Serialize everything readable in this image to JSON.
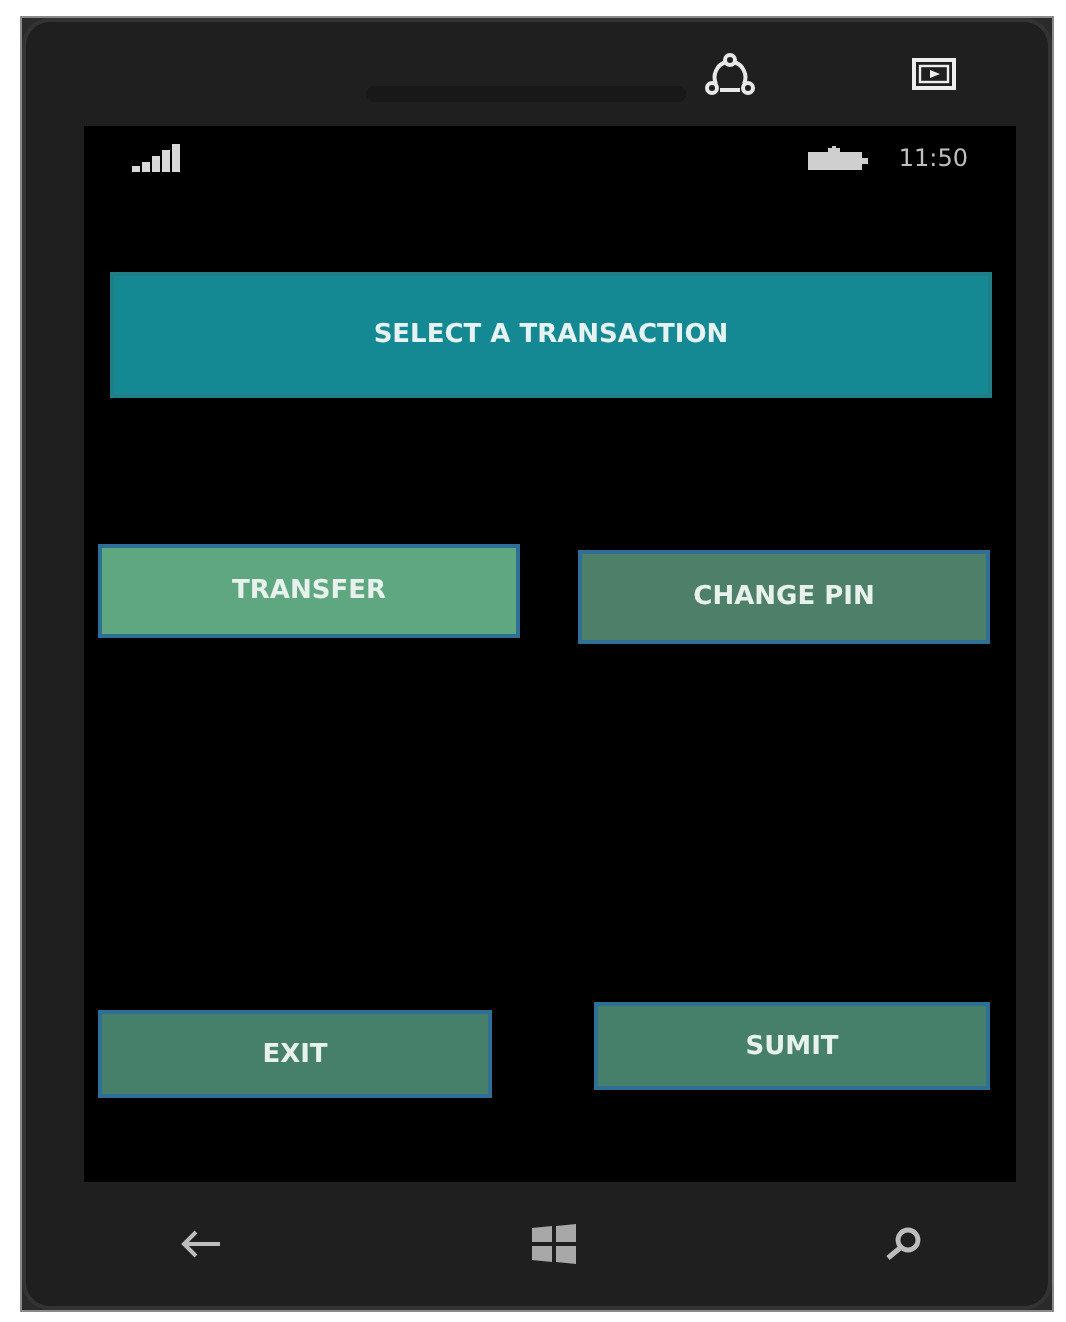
{
  "status_bar": {
    "time": "11:50"
  },
  "header": {
    "title": "SELECT A TRANSACTION"
  },
  "buttons": [
    {
      "label": "TRANSFER"
    },
    {
      "label": "CHANGE PIN"
    },
    {
      "label": "EXIT"
    },
    {
      "label": "SUMIT"
    }
  ]
}
